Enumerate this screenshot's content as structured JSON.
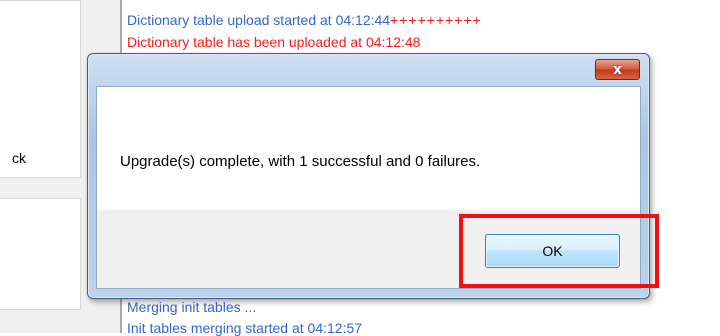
{
  "left_panel": {
    "partial_label": "ck"
  },
  "log": {
    "lines": [
      {
        "text": "Dictionary table upload started at 04:12:44",
        "suffix": "++++++++++"
      },
      {
        "text": "Dictionary table has been uploaded at 04:12:48"
      },
      {
        "text": "Merging init tables ..."
      },
      {
        "text": "Init tables merging started at 04:12:57"
      }
    ]
  },
  "dialog": {
    "close_symbol": "x",
    "message": "Upgrade(s) complete, with 1 successful and 0 failures.",
    "ok_label": "OK"
  },
  "colors": {
    "log_blue": "#3366cc",
    "log_red": "#ff1a1a",
    "highlight_red": "#ee1111",
    "close_red": "#c2391e"
  }
}
